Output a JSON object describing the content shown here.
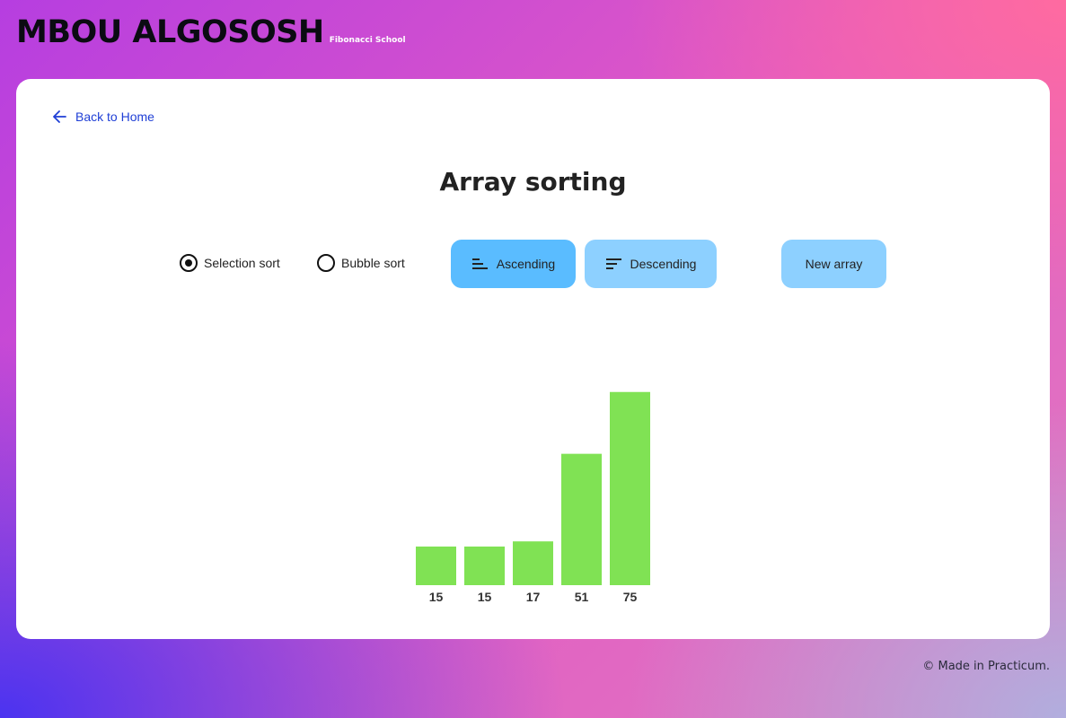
{
  "header": {
    "logo": "MBOU ALGOSOSH",
    "subtitle": "Fibonacci School"
  },
  "nav": {
    "back_label": "Back to Home"
  },
  "page": {
    "title": "Array sorting"
  },
  "controls": {
    "sort_methods": [
      {
        "label": "Selection sort",
        "selected": true
      },
      {
        "label": "Bubble sort",
        "selected": false
      }
    ],
    "ascending_label": "Ascending",
    "descending_label": "Descending",
    "new_array_label": "New array"
  },
  "chart_data": {
    "type": "bar",
    "categories": [
      "15",
      "15",
      "17",
      "51",
      "75"
    ],
    "values": [
      15,
      15,
      17,
      51,
      75
    ],
    "bar_color": "#80e254"
  },
  "footer": {
    "text": "© Made in Practicum."
  },
  "colors": {
    "link": "#1f3fd6",
    "button_active": "#5abcff",
    "button_default": "#8dd0ff"
  }
}
